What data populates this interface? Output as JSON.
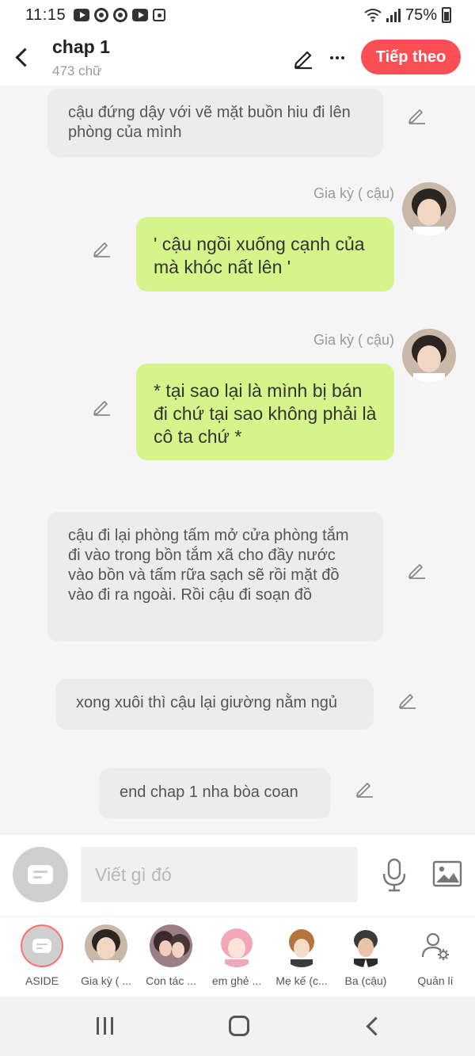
{
  "status": {
    "time": "11:15",
    "battery": "75%",
    "notification_icons": [
      "youtube-icon",
      "chrome-icon",
      "chrome-icon",
      "youtube-icon",
      "camera-icon"
    ]
  },
  "header": {
    "title": "chap 1",
    "word_count": "473 chữ",
    "next_label": "Tiếp theo"
  },
  "messages": [
    {
      "type": "narration",
      "text": "cậu đứng dậy với vẽ mặt buồn hiu đi lên phòng của mình"
    },
    {
      "type": "character",
      "speaker": "Gia kỳ ( cậu)",
      "text": "' cậu ngồi xuống cạnh của mà khóc nất lên '"
    },
    {
      "type": "character",
      "speaker": "Gia kỳ ( cậu)",
      "text": "* tại sao lại là mình bị bán đi chứ tại sao không phải là cô ta chứ *"
    },
    {
      "type": "narration",
      "text": "cậu đi lại phòng tấm mở cửa phòng tắm đi vào trong bồn tắm xã cho đầy nước vào bồn và tấm rữa sạch sẽ rồi mặt đồ vào đi ra ngoài. Rồi cậu đi soạn đồ"
    },
    {
      "type": "narration",
      "text": "xong xuôi thì cậu lại giường nằm ngủ"
    },
    {
      "type": "narration",
      "text": "end chap 1 nha bòa coan"
    }
  ],
  "composer": {
    "placeholder": "Viết gì đó"
  },
  "characters": [
    {
      "label": "ASIDE"
    },
    {
      "label": "Gia kỳ ( ..."
    },
    {
      "label": "Con tác ..."
    },
    {
      "label": "em ghẻ ..."
    },
    {
      "label": "Mẹ kế (c..."
    },
    {
      "label": "Ba (cậu)"
    },
    {
      "label": "Quản lí"
    }
  ],
  "colors": {
    "accent": "#fb4f55",
    "character_bubble": "#d5f48a",
    "narration_bubble": "#ececec",
    "background": "#f5f5f5"
  }
}
